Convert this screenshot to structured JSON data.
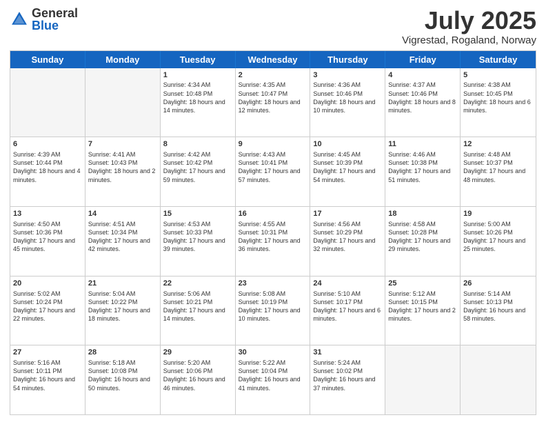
{
  "header": {
    "logo": {
      "general": "General",
      "blue": "Blue"
    },
    "title": "July 2025",
    "subtitle": "Vigrestad, Rogaland, Norway"
  },
  "calendar": {
    "days": [
      "Sunday",
      "Monday",
      "Tuesday",
      "Wednesday",
      "Thursday",
      "Friday",
      "Saturday"
    ],
    "rows": [
      [
        {
          "day": "",
          "info": "",
          "empty": true
        },
        {
          "day": "",
          "info": "",
          "empty": true
        },
        {
          "day": "1",
          "info": "Sunrise: 4:34 AM\nSunset: 10:48 PM\nDaylight: 18 hours and 14 minutes.",
          "empty": false
        },
        {
          "day": "2",
          "info": "Sunrise: 4:35 AM\nSunset: 10:47 PM\nDaylight: 18 hours and 12 minutes.",
          "empty": false
        },
        {
          "day": "3",
          "info": "Sunrise: 4:36 AM\nSunset: 10:46 PM\nDaylight: 18 hours and 10 minutes.",
          "empty": false
        },
        {
          "day": "4",
          "info": "Sunrise: 4:37 AM\nSunset: 10:46 PM\nDaylight: 18 hours and 8 minutes.",
          "empty": false
        },
        {
          "day": "5",
          "info": "Sunrise: 4:38 AM\nSunset: 10:45 PM\nDaylight: 18 hours and 6 minutes.",
          "empty": false
        }
      ],
      [
        {
          "day": "6",
          "info": "Sunrise: 4:39 AM\nSunset: 10:44 PM\nDaylight: 18 hours and 4 minutes.",
          "empty": false
        },
        {
          "day": "7",
          "info": "Sunrise: 4:41 AM\nSunset: 10:43 PM\nDaylight: 18 hours and 2 minutes.",
          "empty": false
        },
        {
          "day": "8",
          "info": "Sunrise: 4:42 AM\nSunset: 10:42 PM\nDaylight: 17 hours and 59 minutes.",
          "empty": false
        },
        {
          "day": "9",
          "info": "Sunrise: 4:43 AM\nSunset: 10:41 PM\nDaylight: 17 hours and 57 minutes.",
          "empty": false
        },
        {
          "day": "10",
          "info": "Sunrise: 4:45 AM\nSunset: 10:39 PM\nDaylight: 17 hours and 54 minutes.",
          "empty": false
        },
        {
          "day": "11",
          "info": "Sunrise: 4:46 AM\nSunset: 10:38 PM\nDaylight: 17 hours and 51 minutes.",
          "empty": false
        },
        {
          "day": "12",
          "info": "Sunrise: 4:48 AM\nSunset: 10:37 PM\nDaylight: 17 hours and 48 minutes.",
          "empty": false
        }
      ],
      [
        {
          "day": "13",
          "info": "Sunrise: 4:50 AM\nSunset: 10:36 PM\nDaylight: 17 hours and 45 minutes.",
          "empty": false
        },
        {
          "day": "14",
          "info": "Sunrise: 4:51 AM\nSunset: 10:34 PM\nDaylight: 17 hours and 42 minutes.",
          "empty": false
        },
        {
          "day": "15",
          "info": "Sunrise: 4:53 AM\nSunset: 10:33 PM\nDaylight: 17 hours and 39 minutes.",
          "empty": false
        },
        {
          "day": "16",
          "info": "Sunrise: 4:55 AM\nSunset: 10:31 PM\nDaylight: 17 hours and 36 minutes.",
          "empty": false
        },
        {
          "day": "17",
          "info": "Sunrise: 4:56 AM\nSunset: 10:29 PM\nDaylight: 17 hours and 32 minutes.",
          "empty": false
        },
        {
          "day": "18",
          "info": "Sunrise: 4:58 AM\nSunset: 10:28 PM\nDaylight: 17 hours and 29 minutes.",
          "empty": false
        },
        {
          "day": "19",
          "info": "Sunrise: 5:00 AM\nSunset: 10:26 PM\nDaylight: 17 hours and 25 minutes.",
          "empty": false
        }
      ],
      [
        {
          "day": "20",
          "info": "Sunrise: 5:02 AM\nSunset: 10:24 PM\nDaylight: 17 hours and 22 minutes.",
          "empty": false
        },
        {
          "day": "21",
          "info": "Sunrise: 5:04 AM\nSunset: 10:22 PM\nDaylight: 17 hours and 18 minutes.",
          "empty": false
        },
        {
          "day": "22",
          "info": "Sunrise: 5:06 AM\nSunset: 10:21 PM\nDaylight: 17 hours and 14 minutes.",
          "empty": false
        },
        {
          "day": "23",
          "info": "Sunrise: 5:08 AM\nSunset: 10:19 PM\nDaylight: 17 hours and 10 minutes.",
          "empty": false
        },
        {
          "day": "24",
          "info": "Sunrise: 5:10 AM\nSunset: 10:17 PM\nDaylight: 17 hours and 6 minutes.",
          "empty": false
        },
        {
          "day": "25",
          "info": "Sunrise: 5:12 AM\nSunset: 10:15 PM\nDaylight: 17 hours and 2 minutes.",
          "empty": false
        },
        {
          "day": "26",
          "info": "Sunrise: 5:14 AM\nSunset: 10:13 PM\nDaylight: 16 hours and 58 minutes.",
          "empty": false
        }
      ],
      [
        {
          "day": "27",
          "info": "Sunrise: 5:16 AM\nSunset: 10:11 PM\nDaylight: 16 hours and 54 minutes.",
          "empty": false
        },
        {
          "day": "28",
          "info": "Sunrise: 5:18 AM\nSunset: 10:08 PM\nDaylight: 16 hours and 50 minutes.",
          "empty": false
        },
        {
          "day": "29",
          "info": "Sunrise: 5:20 AM\nSunset: 10:06 PM\nDaylight: 16 hours and 46 minutes.",
          "empty": false
        },
        {
          "day": "30",
          "info": "Sunrise: 5:22 AM\nSunset: 10:04 PM\nDaylight: 16 hours and 41 minutes.",
          "empty": false
        },
        {
          "day": "31",
          "info": "Sunrise: 5:24 AM\nSunset: 10:02 PM\nDaylight: 16 hours and 37 minutes.",
          "empty": false
        },
        {
          "day": "",
          "info": "",
          "empty": true
        },
        {
          "day": "",
          "info": "",
          "empty": true
        }
      ]
    ]
  }
}
